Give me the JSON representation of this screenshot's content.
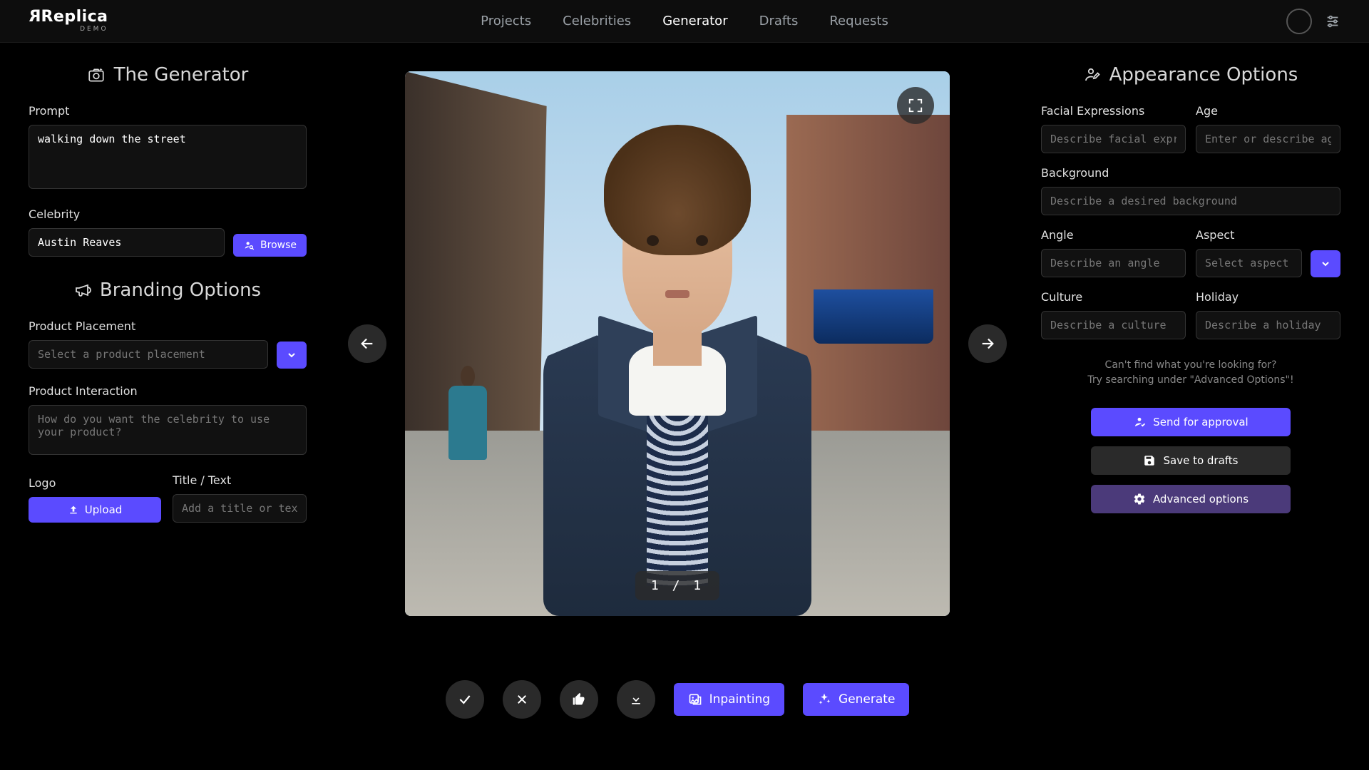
{
  "brand": {
    "name": "Replica",
    "sub": "DEMO"
  },
  "nav": {
    "items": [
      "Projects",
      "Celebrities",
      "Generator",
      "Drafts",
      "Requests"
    ],
    "active": "Generator"
  },
  "left": {
    "generator_title": "The Generator",
    "prompt_label": "Prompt",
    "prompt_value": "walking down the street",
    "celebrity_label": "Celebrity",
    "celebrity_value": "Austin Reaves",
    "browse_label": "Browse",
    "branding_title": "Branding Options",
    "product_placement_label": "Product Placement",
    "product_placement_placeholder": "Select a product placement",
    "product_interaction_label": "Product Interaction",
    "product_interaction_placeholder": "How do you want the celebrity to use your product?",
    "logo_label": "Logo",
    "upload_label": "Upload",
    "title_text_label": "Title / Text",
    "title_text_placeholder": "Add a title or text"
  },
  "center": {
    "pager": "1 / 1",
    "accept_tt": "Accept",
    "reject_tt": "Reject",
    "like_tt": "Like",
    "download_tt": "Download",
    "inpainting_label": "Inpainting",
    "generate_label": "Generate"
  },
  "right": {
    "title": "Appearance Options",
    "facial_label": "Facial Expressions",
    "facial_ph": "Describe facial expressions",
    "age_label": "Age",
    "age_ph": "Enter or describe age",
    "background_label": "Background",
    "background_ph": "Describe a desired background",
    "angle_label": "Angle",
    "angle_ph": "Describe an angle",
    "aspect_label": "Aspect",
    "aspect_ph": "Select aspect",
    "culture_label": "Culture",
    "culture_ph": "Describe a culture",
    "holiday_label": "Holiday",
    "holiday_ph": "Describe a holiday",
    "hint_line1": "Can't find what you're looking for?",
    "hint_line2": "Try searching under \"Advanced Options\"!",
    "send_label": "Send for approval",
    "save_label": "Save to drafts",
    "advanced_label": "Advanced options"
  }
}
